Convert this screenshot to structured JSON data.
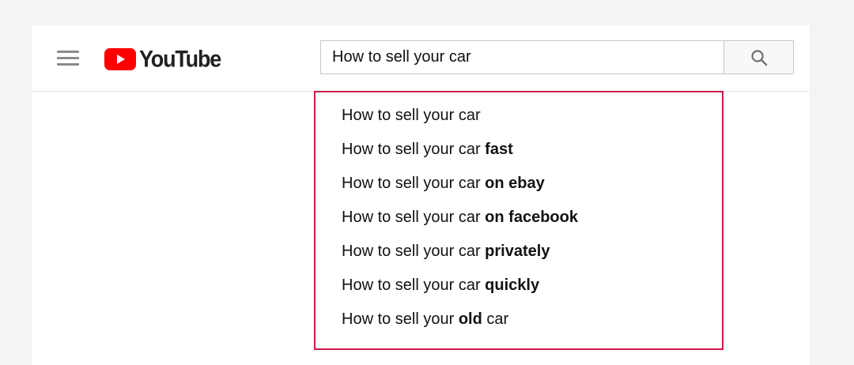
{
  "header": {
    "logo_text": "YouTube",
    "menu_icon": "hamburger-menu-icon",
    "search_icon": "search-icon"
  },
  "search": {
    "value": "How to sell your car"
  },
  "suggestions": [
    {
      "segments": [
        {
          "text": "How to sell your car",
          "bold": false
        }
      ]
    },
    {
      "segments": [
        {
          "text": "How to sell your car ",
          "bold": false
        },
        {
          "text": "fast",
          "bold": true
        }
      ]
    },
    {
      "segments": [
        {
          "text": "How to sell your car ",
          "bold": false
        },
        {
          "text": "on ebay",
          "bold": true
        }
      ]
    },
    {
      "segments": [
        {
          "text": "How to sell your car ",
          "bold": false
        },
        {
          "text": "on facebook",
          "bold": true
        }
      ]
    },
    {
      "segments": [
        {
          "text": "How to sell your car ",
          "bold": false
        },
        {
          "text": "privately",
          "bold": true
        }
      ]
    },
    {
      "segments": [
        {
          "text": "How to sell your car ",
          "bold": false
        },
        {
          "text": "quickly",
          "bold": true
        }
      ]
    },
    {
      "segments": [
        {
          "text": "How to sell your ",
          "bold": false
        },
        {
          "text": "old",
          "bold": true
        },
        {
          "text": " car",
          "bold": false
        }
      ]
    }
  ],
  "colors": {
    "brand_red": "#ff0000",
    "highlight_border": "#d2164a"
  }
}
